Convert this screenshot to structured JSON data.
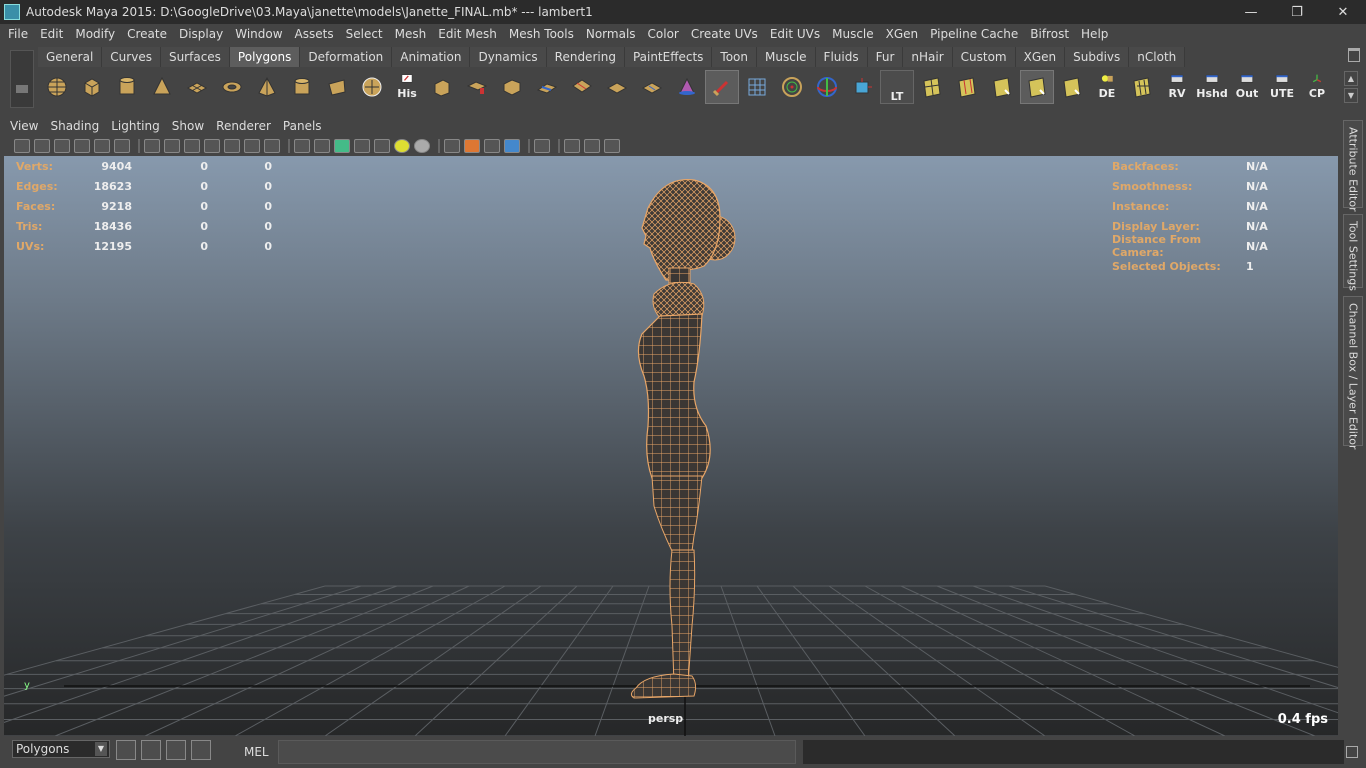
{
  "window": {
    "title": "Autodesk Maya 2015: D:\\GoogleDrive\\03.Maya\\janette\\models\\Janette_FINAL.mb*   ---   lambert1",
    "minimize": "—",
    "maximize": "❐",
    "close": "✕"
  },
  "menu": [
    "File",
    "Edit",
    "Modify",
    "Create",
    "Display",
    "Window",
    "Assets",
    "Select",
    "Mesh",
    "Edit Mesh",
    "Mesh Tools",
    "Normals",
    "Color",
    "Create UVs",
    "Edit UVs",
    "Muscle",
    "XGen",
    "Pipeline Cache",
    "Bifrost",
    "Help"
  ],
  "shelf": {
    "tabs": [
      "General",
      "Curves",
      "Surfaces",
      "Polygons",
      "Deformation",
      "Animation",
      "Dynamics",
      "Rendering",
      "PaintEffects",
      "Toon",
      "Muscle",
      "Fluids",
      "Fur",
      "nHair",
      "Custom",
      "XGen",
      "Subdivs",
      "nCloth"
    ],
    "active_tab": "Polygons",
    "labeled_icons": [
      "His",
      "LT",
      "DE",
      "RV",
      "Hshd",
      "Out",
      "UTE",
      "CP"
    ]
  },
  "panel_menu": [
    "View",
    "Shading",
    "Lighting",
    "Show",
    "Renderer",
    "Panels"
  ],
  "hud_left": [
    {
      "label": "Verts:",
      "value": "9404",
      "sel": "0",
      "uv": "0"
    },
    {
      "label": "Edges:",
      "value": "18623",
      "sel": "0",
      "uv": "0"
    },
    {
      "label": "Faces:",
      "value": "9218",
      "sel": "0",
      "uv": "0"
    },
    {
      "label": "Tris:",
      "value": "18436",
      "sel": "0",
      "uv": "0"
    },
    {
      "label": "UVs:",
      "value": "12195",
      "sel": "0",
      "uv": "0"
    }
  ],
  "hud_right": [
    {
      "label": "Backfaces:",
      "value": "N/A"
    },
    {
      "label": "Smoothness:",
      "value": "N/A"
    },
    {
      "label": "Instance:",
      "value": "N/A"
    },
    {
      "label": "Display Layer:",
      "value": "N/A"
    },
    {
      "label": "Distance From Camera:",
      "value": "N/A"
    },
    {
      "label": "Selected Objects:",
      "value": "1"
    }
  ],
  "camera": "persp",
  "fps": "0.4 fps",
  "axis_label": "y",
  "side_tabs": [
    "Attribute Editor",
    "Tool Settings",
    "Channel Box / Layer Editor"
  ],
  "cmdline": {
    "mode": "Polygons",
    "mel": "MEL"
  },
  "colors": {
    "wire": "#e8a668",
    "hud_label": "#e0a868"
  }
}
